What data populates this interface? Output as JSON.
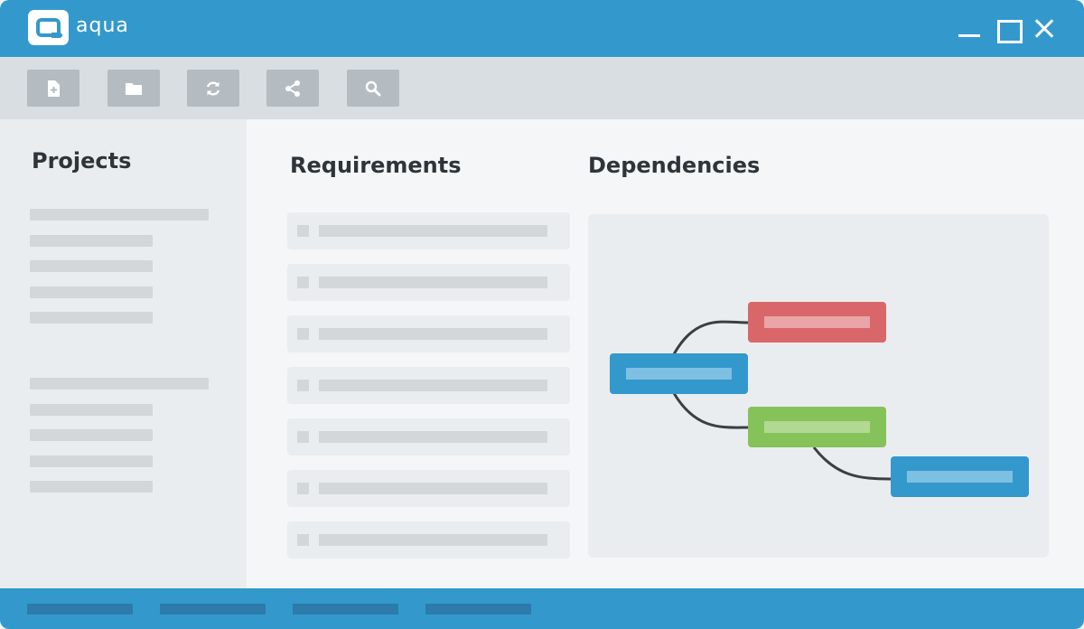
{
  "app": {
    "name": "aqua"
  },
  "colors": {
    "brand": "#3399cc",
    "toolbar": "#d9dee2",
    "tool_button": "#b5bcc1",
    "placeholder": "#d3d7da",
    "node_red": "#d9676a",
    "node_green": "#86c25a",
    "node_blue": "#3399cc",
    "connector": "#3b3f42"
  },
  "toolbar": {
    "buttons": [
      {
        "icon": "new-file-icon"
      },
      {
        "icon": "folder-icon"
      },
      {
        "icon": "refresh-icon"
      },
      {
        "icon": "share-icon"
      },
      {
        "icon": "search-icon"
      }
    ]
  },
  "sidebar": {
    "title": "Projects"
  },
  "requirements": {
    "title": "Requirements"
  },
  "dependencies": {
    "title": "Dependencies",
    "nodes": [
      {
        "id": "root",
        "color": "blue"
      },
      {
        "id": "child-red",
        "color": "red"
      },
      {
        "id": "child-green",
        "color": "green"
      },
      {
        "id": "grandchild-blue",
        "color": "blue"
      }
    ],
    "edges": [
      {
        "from": "root",
        "to": "child-red"
      },
      {
        "from": "root",
        "to": "child-green"
      },
      {
        "from": "child-green",
        "to": "grandchild-blue"
      }
    ]
  }
}
